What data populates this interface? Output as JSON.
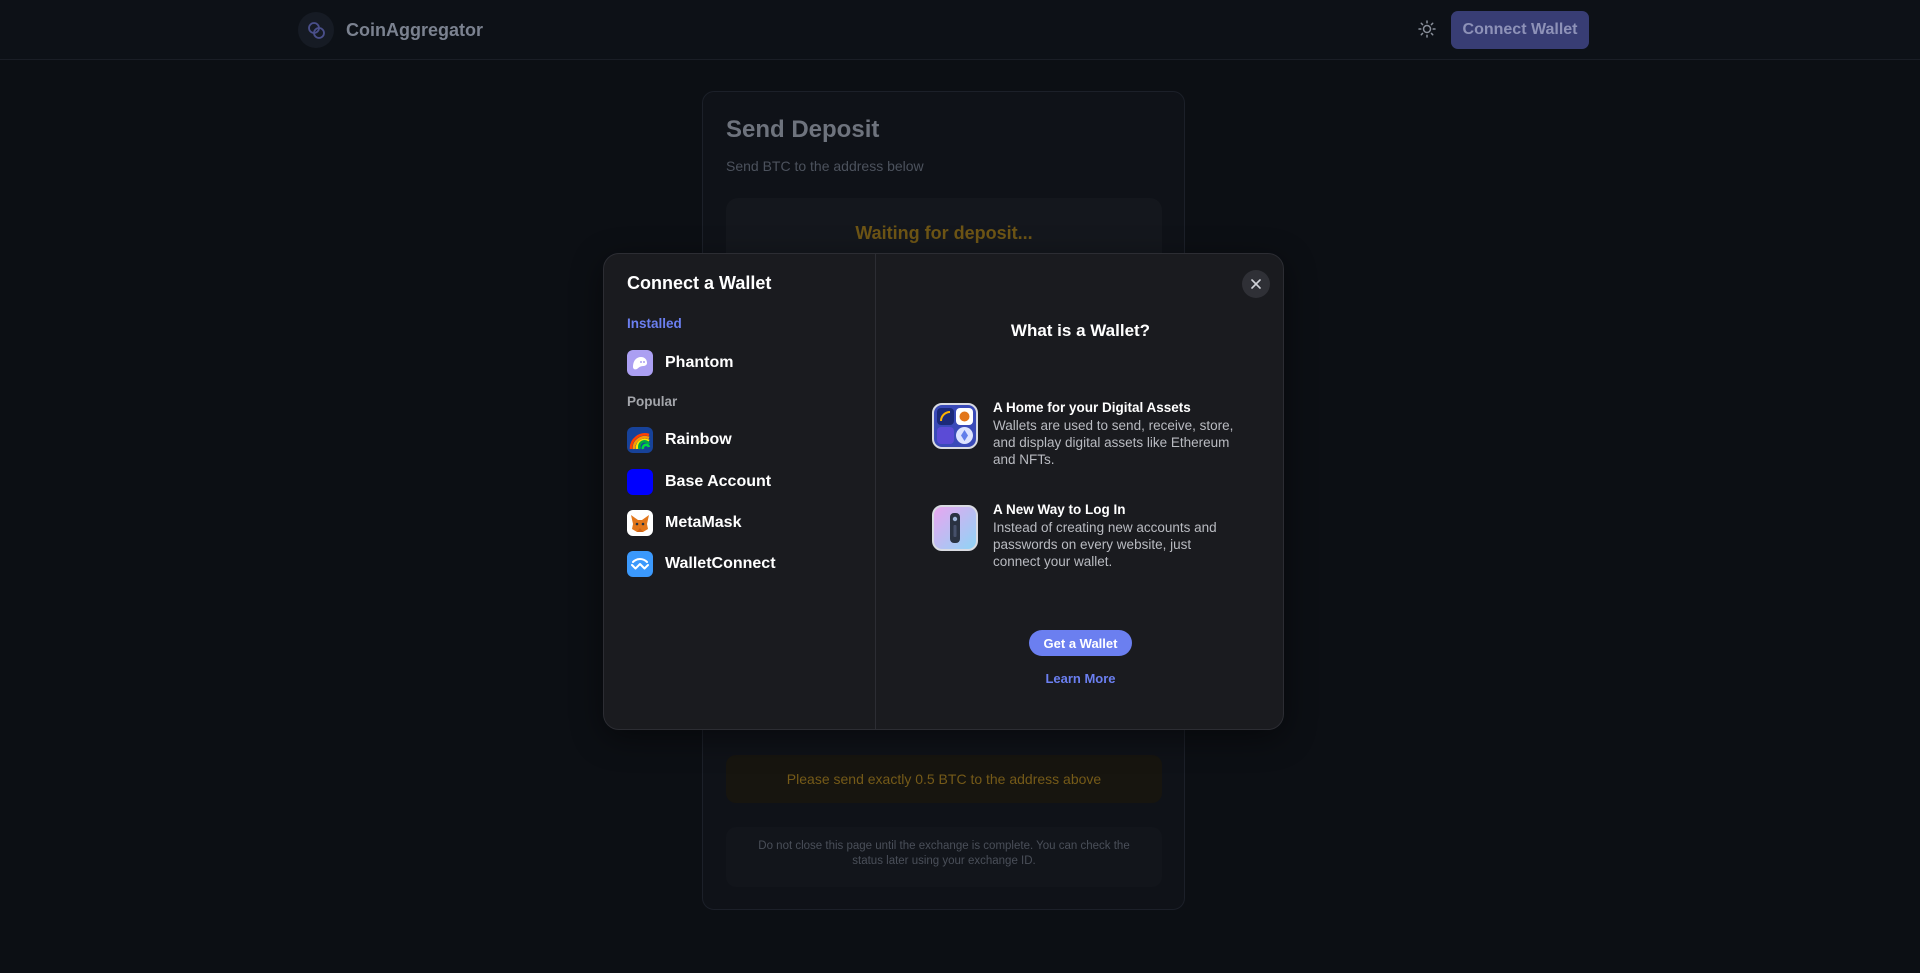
{
  "header": {
    "brand_name": "CoinAggregator",
    "connect_label": "Connect Wallet"
  },
  "deposit": {
    "title": "Send Deposit",
    "subtitle": "Send BTC to the address below",
    "status": "Waiting for deposit...",
    "instruction": "Please send exactly 0.5 BTC to the address above",
    "note": "Do not close this page until the exchange is complete. You can check the status later using your exchange ID."
  },
  "modal": {
    "title": "Connect a Wallet",
    "groups": [
      {
        "label": "Installed",
        "wallets": [
          {
            "label": "Phantom",
            "icon": "phantom-icon"
          }
        ]
      },
      {
        "label": "Popular",
        "wallets": [
          {
            "label": "Rainbow",
            "icon": "rainbow-icon"
          },
          {
            "label": "Base Account",
            "icon": "base-account-icon"
          },
          {
            "label": "MetaMask",
            "icon": "metamask-fox-icon"
          },
          {
            "label": "WalletConnect",
            "icon": "walletconnect-icon"
          }
        ]
      }
    ],
    "info": {
      "title": "What is a Wallet?",
      "items": [
        {
          "heading": "A Home for your Digital Assets",
          "body": "Wallets are used to send, receive, store, and display digital assets like Ethereum and NFTs.",
          "icon": "digital-assets-icon"
        },
        {
          "heading": "A New Way to Log In",
          "body": "Instead of creating new accounts and passwords on every website, just connect your wallet.",
          "icon": "login-key-icon"
        }
      ],
      "get_wallet_label": "Get a Wallet",
      "learn_more_label": "Learn More"
    }
  },
  "colors": {
    "accent": "#6b7ff0",
    "background": "#0c0f14",
    "modal_background": "#1a1b1f",
    "warning_text": "#755a18"
  }
}
